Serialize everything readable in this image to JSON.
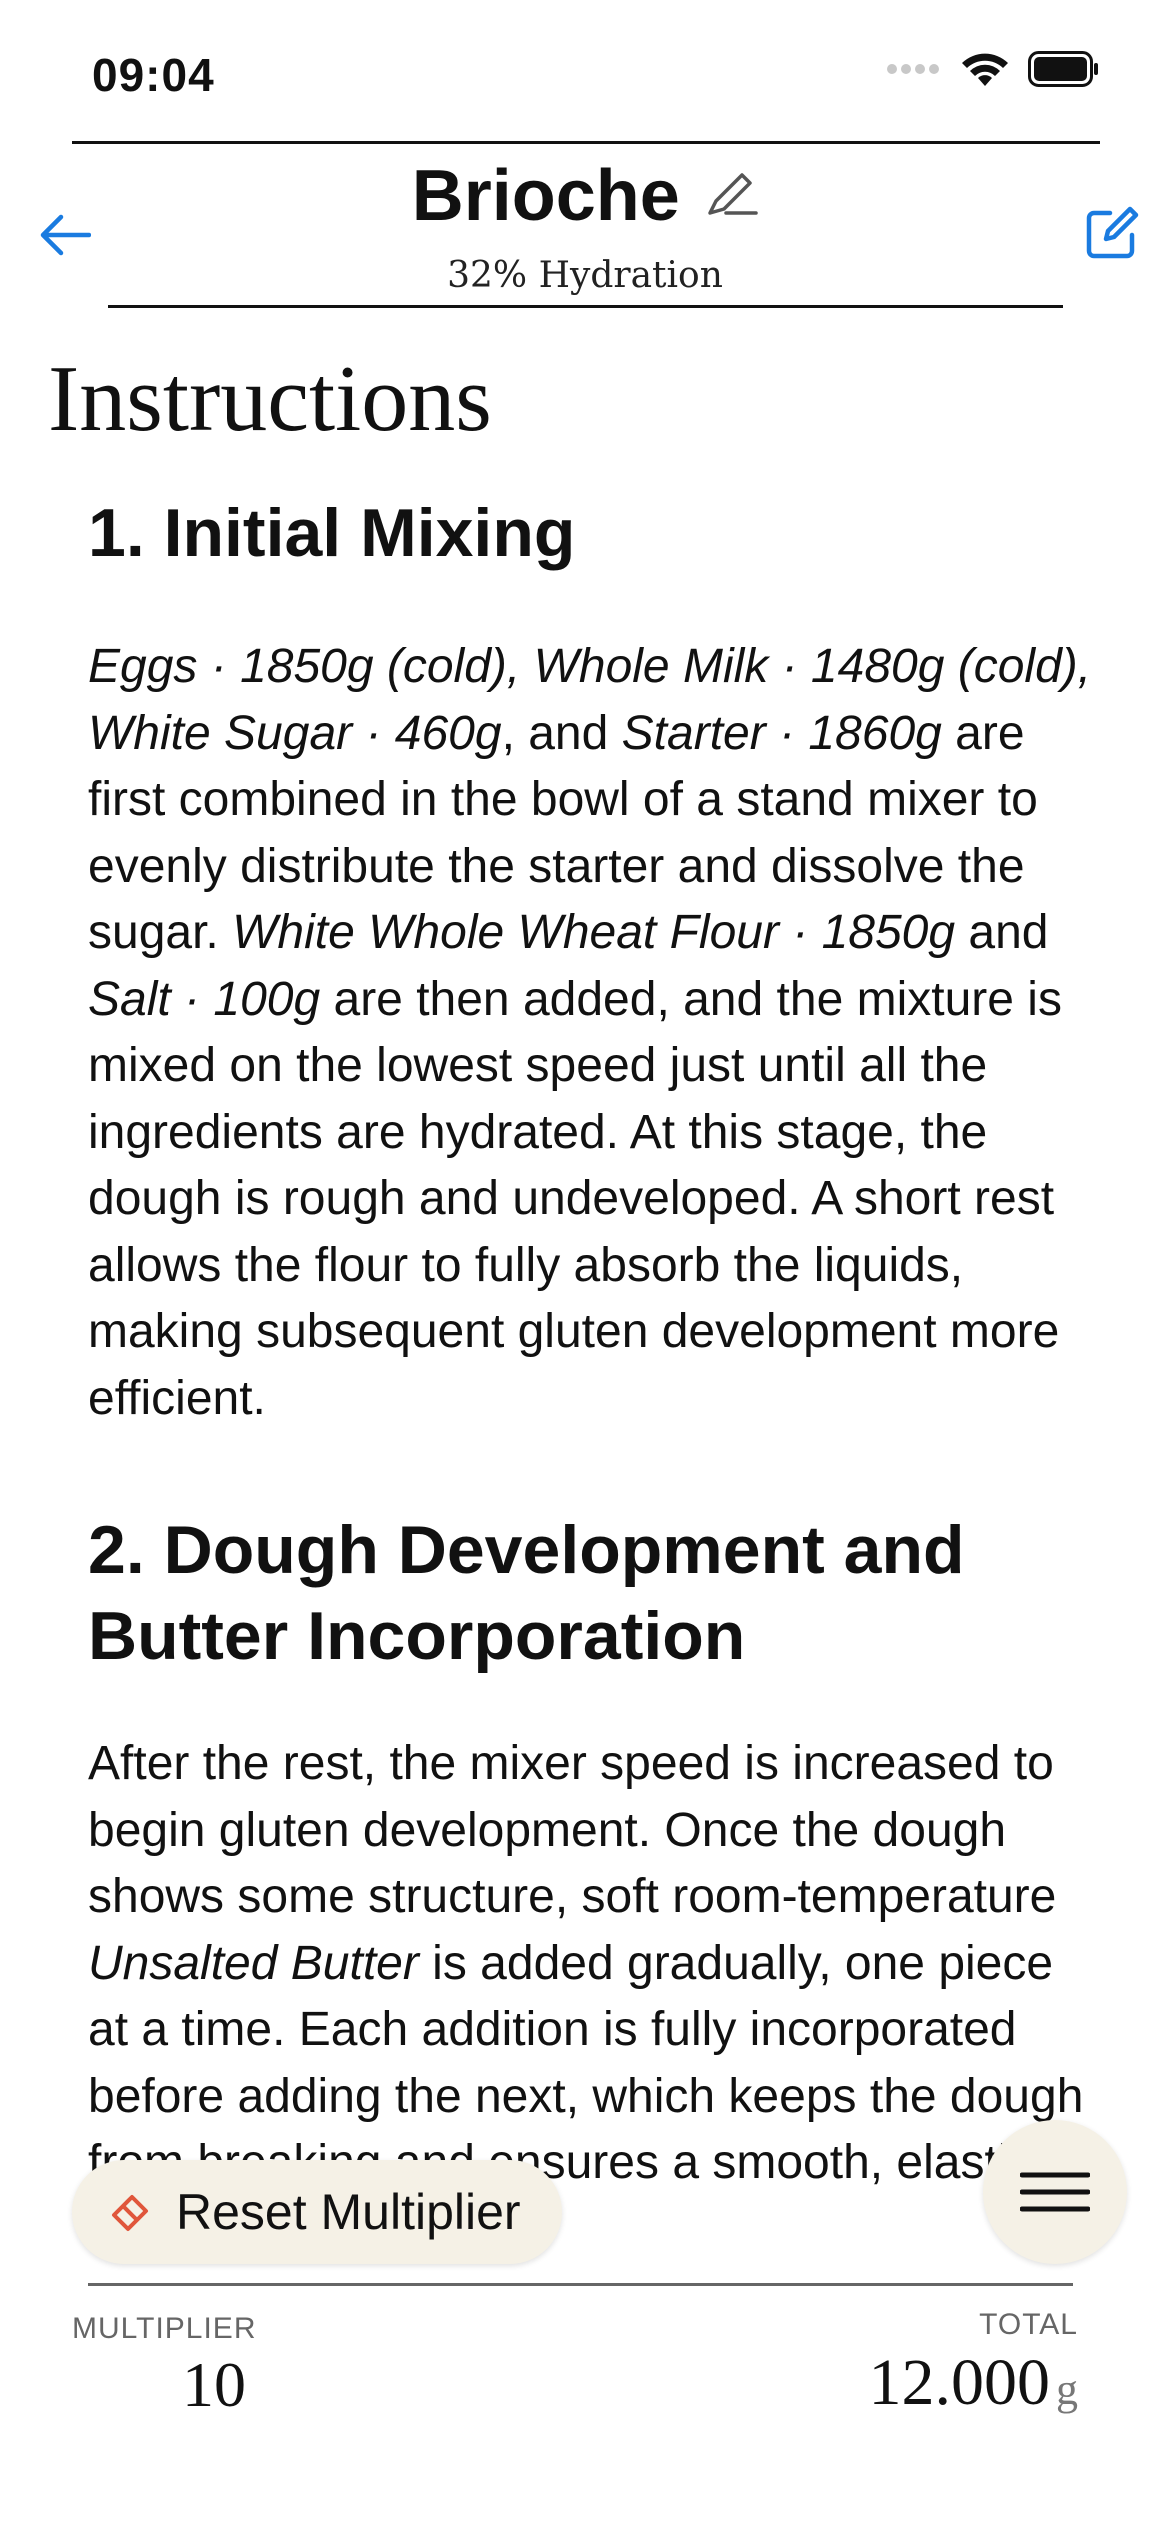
{
  "status": {
    "time": "09:04"
  },
  "nav": {
    "title": "Brioche",
    "subtitle": "32% Hydration"
  },
  "page": {
    "heading": "Instructions"
  },
  "sections": [
    {
      "title": "1. Initial Mixing",
      "body": [
        {
          "t": "Eggs · 1850g (cold), Whole Milk · 1480g (cold), White Sugar · 460g",
          "i": true
        },
        {
          "t": ", and ",
          "i": false
        },
        {
          "t": "Starter · 1860g",
          "i": true
        },
        {
          "t": " are first combined in the bowl of a stand mixer to evenly distribute the starter and dissolve the sugar. ",
          "i": false
        },
        {
          "t": "White Whole Wheat Flour · 1850g",
          "i": true
        },
        {
          "t": " and ",
          "i": false
        },
        {
          "t": "Salt · 100g",
          "i": true
        },
        {
          "t": " are then added, and the mixture is mixed on the lowest speed just until all the ingredients are hydrated. At this stage, the dough is rough and undeveloped. A short rest allows the flour to fully absorb the liquids, making subsequent gluten development more efficient.",
          "i": false
        }
      ]
    },
    {
      "title": "2. Dough Development and Butter Incorporation",
      "body": [
        {
          "t": "After the rest, the mixer speed is increased to begin gluten development. Once the dough shows some structure, soft room-temperature ",
          "i": false
        },
        {
          "t": "Unsalted Butter",
          "i": true
        },
        {
          "t": " is added gradually, one piece at a time. Each addition is fully incorporated before adding the next, which keeps the dough from breaking and ensures a smooth, elastic texture.",
          "i": false
        }
      ]
    }
  ],
  "footer": {
    "reset_label": "Reset Multiplier",
    "multiplier_label": "MULTIPLIER",
    "multiplier_value": "10",
    "total_label": "TOTAL",
    "total_value": "12.000",
    "total_unit": "g"
  },
  "colors": {
    "accent": "#1a7be0",
    "button_bg": "#f5f1e6",
    "reset_icon": "#e0563b"
  }
}
